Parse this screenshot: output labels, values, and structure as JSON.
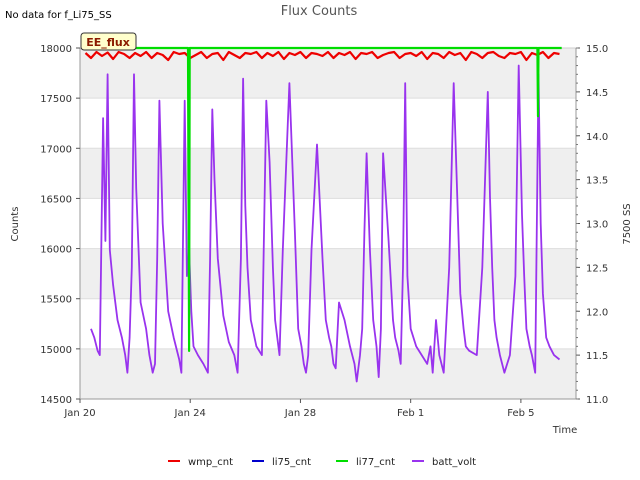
{
  "chart_data": {
    "type": "line",
    "title": "Flux Counts",
    "note": "No data for f_Li75_SS",
    "badge": "EE_flux",
    "xlabel": "Time",
    "ylabel": "Counts",
    "y2label": "7500 SS",
    "xlim": [
      0,
      45
    ],
    "ylim": [
      14500,
      18000
    ],
    "y2lim": [
      11.0,
      15.0
    ],
    "x_ticks": [
      {
        "x": 0,
        "label": "Jan 20"
      },
      {
        "x": 10,
        "label": "Jan 24"
      },
      {
        "x": 20,
        "label": "Jan 28"
      },
      {
        "x": 30,
        "label": "Feb 1"
      },
      {
        "x": 40,
        "label": "Feb 5"
      }
    ],
    "y_ticks": [
      14500,
      15000,
      15500,
      16000,
      16500,
      17000,
      17500,
      18000
    ],
    "y2_ticks": [
      "11.0",
      "11.5",
      "12.0",
      "12.5",
      "13.0",
      "13.5",
      "14.0",
      "14.5",
      "15.0"
    ],
    "legend": {
      "placement": "bottom-center"
    },
    "colors": {
      "wmp_cnt": "#ee0000",
      "li75_cnt": "#0000cc",
      "li77_cnt": "#00dd00",
      "batt_volt": "#9933ee",
      "band": "#efefef",
      "grid": "#dddddd"
    },
    "series": [
      {
        "name": "wmp_cnt",
        "axis": "left",
        "x": [
          0.5,
          1,
          1.5,
          2,
          2.5,
          3,
          3.5,
          4,
          4.5,
          5,
          5.5,
          6,
          6.5,
          7,
          7.5,
          8,
          8.5,
          9,
          9.5,
          10,
          10.5,
          11,
          11.5,
          12,
          12.5,
          13,
          13.5,
          14,
          14.5,
          15,
          15.5,
          16,
          16.5,
          17,
          17.5,
          18,
          18.5,
          19,
          19.5,
          20,
          20.5,
          21,
          21.5,
          22,
          22.5,
          23,
          23.5,
          24,
          24.5,
          25,
          25.5,
          26,
          26.5,
          27,
          27.5,
          28,
          28.5,
          29,
          29.5,
          30,
          30.5,
          31,
          31.5,
          32,
          32.5,
          33,
          33.5,
          34,
          34.5,
          35,
          35.5,
          36,
          36.5,
          37,
          37.5,
          38,
          38.5,
          39,
          39.5,
          40,
          40.5,
          41,
          41.5,
          42,
          42.5,
          43,
          43.5
        ],
        "values": [
          17950,
          17900,
          17960,
          17920,
          17955,
          17890,
          17960,
          17940,
          17900,
          17950,
          17920,
          17960,
          17900,
          17950,
          17930,
          17880,
          17960,
          17940,
          17950,
          17900,
          17930,
          17960,
          17900,
          17940,
          17950,
          17880,
          17960,
          17930,
          17900,
          17950,
          17940,
          17960,
          17900,
          17950,
          17920,
          17960,
          17890,
          17950,
          17930,
          17960,
          17900,
          17950,
          17940,
          17920,
          17960,
          17900,
          17950,
          17930,
          17960,
          17890,
          17950,
          17940,
          17960,
          17900,
          17930,
          17950,
          17960,
          17900,
          17940,
          17950,
          17920,
          17960,
          17890,
          17950,
          17940,
          17900,
          17960,
          17930,
          17950,
          17880,
          17960,
          17940,
          17900,
          17950,
          17960,
          17920,
          17900,
          17950,
          17940,
          17960,
          17880,
          17950,
          17930,
          17960,
          17900,
          17950,
          17940
        ]
      },
      {
        "name": "li75_cnt",
        "axis": "left",
        "x": [],
        "values": []
      },
      {
        "name": "li77_cnt",
        "axis": "left",
        "x": [
          0.5,
          9.8,
          9.9,
          9.95,
          10,
          41.5,
          41.55,
          41.6,
          41.7,
          43.7
        ],
        "values": [
          18000,
          18000,
          14980,
          18000,
          18000,
          18000,
          17320,
          18000,
          18000,
          18000
        ]
      },
      {
        "name": "batt_volt",
        "axis": "right",
        "x": [
          1.0,
          1.3,
          1.6,
          1.8,
          2.1,
          2.3,
          2.5,
          2.7,
          3.0,
          3.4,
          3.8,
          4.1,
          4.3,
          4.5,
          4.7,
          4.9,
          5.1,
          5.5,
          6.0,
          6.3,
          6.6,
          6.8,
          7.0,
          7.2,
          7.5,
          8.0,
          8.5,
          9.0,
          9.2,
          9.5,
          9.7,
          9.9,
          10.1,
          10.3,
          10.7,
          11.2,
          11.6,
          11.8,
          12.0,
          12.2,
          12.5,
          13.0,
          13.5,
          14.0,
          14.3,
          14.6,
          14.8,
          15.0,
          15.2,
          15.5,
          16.0,
          16.5,
          16.9,
          17.2,
          17.5,
          17.7,
          17.9,
          18.1,
          18.4,
          19.0,
          19.5,
          19.8,
          20.1,
          20.3,
          20.5,
          20.7,
          21.0,
          21.5,
          22.0,
          22.3,
          22.6,
          22.8,
          23.0,
          23.2,
          23.5,
          24.0,
          24.5,
          24.9,
          25.1,
          25.4,
          25.6,
          25.8,
          26.0,
          26.3,
          26.6,
          26.9,
          27.1,
          27.3,
          27.5,
          28.0,
          28.4,
          28.6,
          28.9,
          29.1,
          29.3,
          29.5,
          29.7,
          30.0,
          30.5,
          31.0,
          31.5,
          31.8,
          32.0,
          32.3,
          32.6,
          33.0,
          33.5,
          33.9,
          34.2,
          34.5,
          34.8,
          35.0,
          35.3,
          36.0,
          36.5,
          37.0,
          37.2,
          37.4,
          37.6,
          37.8,
          38.1,
          38.5,
          39.0,
          39.5,
          39.8,
          40.1,
          40.3,
          40.5,
          40.8,
          41.0,
          41.3,
          41.6,
          41.8,
          42.0,
          42.3,
          42.6,
          43.0,
          43.5
        ],
        "values": [
          11.8,
          11.7,
          11.55,
          11.5,
          14.2,
          12.8,
          14.7,
          12.7,
          12.3,
          11.9,
          11.7,
          11.5,
          11.3,
          11.7,
          12.5,
          14.7,
          13.4,
          12.1,
          11.8,
          11.5,
          11.3,
          11.4,
          12.6,
          14.4,
          13.0,
          12.0,
          11.7,
          11.45,
          11.3,
          14.4,
          12.4,
          12.7,
          12.0,
          11.6,
          11.5,
          11.4,
          11.3,
          12.6,
          14.3,
          13.5,
          12.6,
          11.95,
          11.65,
          11.5,
          11.3,
          12.6,
          14.65,
          13.2,
          12.5,
          11.9,
          11.6,
          11.5,
          14.4,
          13.7,
          12.5,
          11.9,
          11.7,
          11.5,
          12.7,
          14.6,
          12.9,
          11.8,
          11.6,
          11.4,
          11.3,
          11.5,
          12.7,
          13.9,
          12.6,
          11.9,
          11.7,
          11.6,
          11.4,
          11.35,
          12.1,
          11.9,
          11.6,
          11.4,
          11.2,
          11.5,
          11.8,
          12.9,
          13.8,
          12.7,
          11.9,
          11.6,
          11.25,
          11.8,
          13.8,
          12.8,
          11.9,
          11.7,
          11.55,
          11.4,
          12.5,
          14.6,
          12.4,
          11.8,
          11.6,
          11.5,
          11.4,
          11.6,
          11.3,
          11.9,
          11.5,
          11.3,
          12.5,
          14.6,
          13.4,
          12.2,
          11.8,
          11.6,
          11.55,
          11.5,
          12.5,
          14.5,
          13.3,
          12.5,
          11.9,
          11.7,
          11.5,
          11.3,
          11.5,
          12.4,
          14.8,
          13.1,
          12.4,
          11.8,
          11.6,
          11.5,
          11.3,
          14.7,
          13.0,
          12.2,
          11.7,
          11.6,
          11.5,
          11.45
        ]
      }
    ]
  }
}
